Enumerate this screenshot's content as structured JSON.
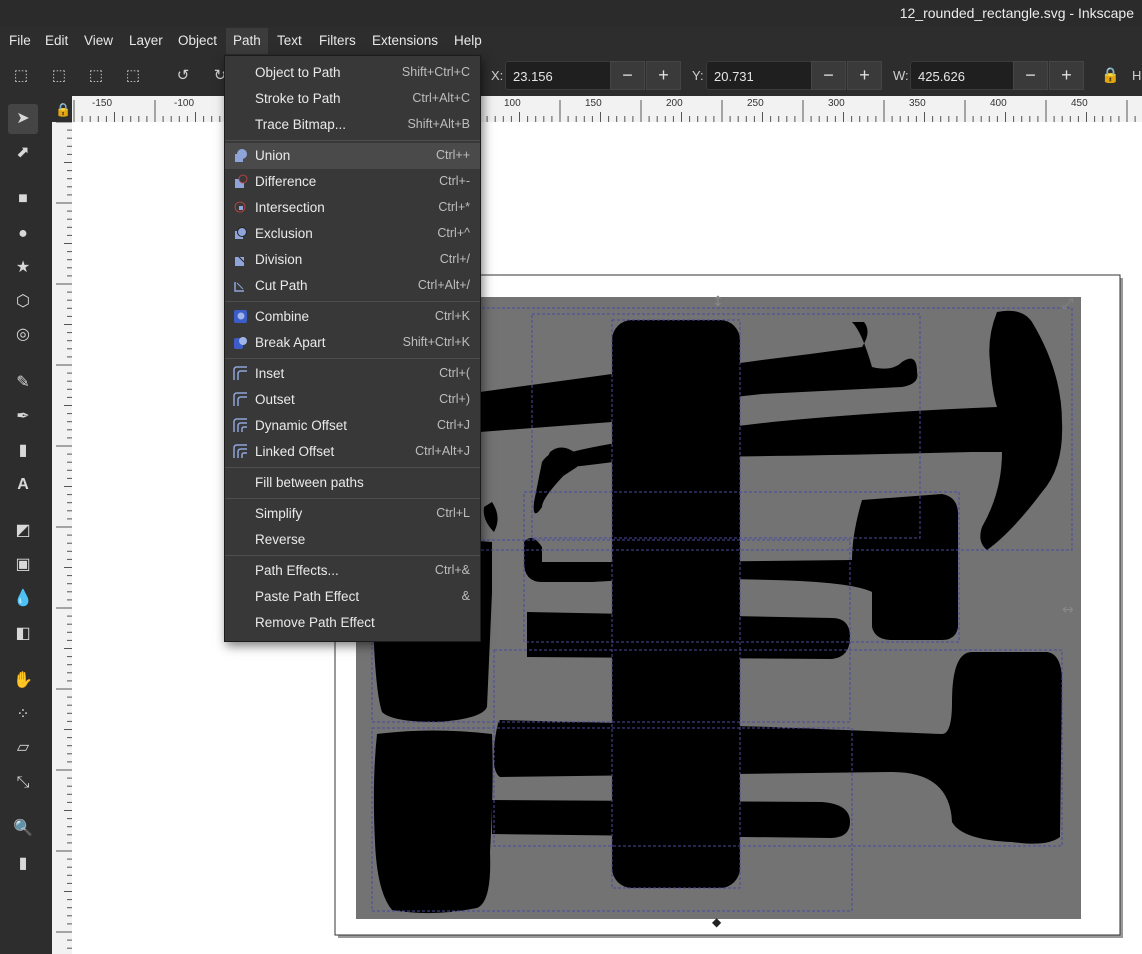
{
  "window": {
    "title": "12_rounded_rectangle.svg - Inkscape"
  },
  "menubar": {
    "items": [
      "File",
      "Edit",
      "View",
      "Layer",
      "Object",
      "Path",
      "Text",
      "Filters",
      "Extensions",
      "Help"
    ],
    "active": "Path"
  },
  "toolbar": {
    "x_label": "X:",
    "x_value": "23.156",
    "y_label": "Y:",
    "y_value": "20.731",
    "w_label": "W:",
    "w_value": "425.626",
    "minus": "−",
    "plus": "+",
    "h_label": "H"
  },
  "ruler": {
    "h_ticks": [
      "-150",
      "-100",
      "100",
      "150",
      "200",
      "250",
      "300",
      "350",
      "400",
      "450"
    ]
  },
  "path_menu": {
    "items": [
      {
        "label": "Object to Path",
        "shortcut": "Shift+Ctrl+C"
      },
      {
        "label": "Stroke to Path",
        "shortcut": "Ctrl+Alt+C"
      },
      {
        "label": "Trace Bitmap...",
        "shortcut": "Shift+Alt+B"
      },
      {
        "label": "Union",
        "shortcut": "Ctrl++"
      },
      {
        "label": "Difference",
        "shortcut": "Ctrl+-"
      },
      {
        "label": "Intersection",
        "shortcut": "Ctrl+*"
      },
      {
        "label": "Exclusion",
        "shortcut": "Ctrl+^"
      },
      {
        "label": "Division",
        "shortcut": "Ctrl+/"
      },
      {
        "label": "Cut Path",
        "shortcut": "Ctrl+Alt+/"
      },
      {
        "label": "Combine",
        "shortcut": "Ctrl+K"
      },
      {
        "label": "Break Apart",
        "shortcut": "Shift+Ctrl+K"
      },
      {
        "label": "Inset",
        "shortcut": "Ctrl+("
      },
      {
        "label": "Outset",
        "shortcut": "Ctrl+)"
      },
      {
        "label": "Dynamic Offset",
        "shortcut": "Ctrl+J"
      },
      {
        "label": "Linked Offset",
        "shortcut": "Ctrl+Alt+J"
      },
      {
        "label": "Fill between paths",
        "shortcut": ""
      },
      {
        "label": "Simplify",
        "shortcut": "Ctrl+L"
      },
      {
        "label": "Reverse",
        "shortcut": ""
      },
      {
        "label": "Path Effects...",
        "shortcut": "Ctrl+&"
      },
      {
        "label": "Paste Path Effect",
        "shortcut": "&"
      },
      {
        "label": "Remove Path Effect",
        "shortcut": ""
      }
    ],
    "highlighted": "Union"
  },
  "colors": {
    "background": "#2d2d2d",
    "menu_bg": "#383838",
    "canvas": "#ffffff",
    "shape_fill": "#000000",
    "page_fill": "#737373"
  }
}
